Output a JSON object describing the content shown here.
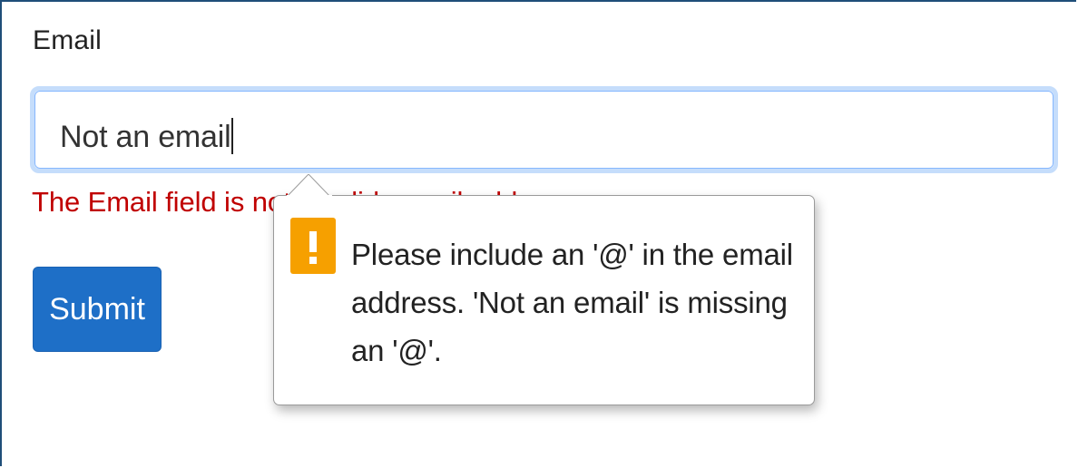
{
  "form": {
    "email_label": "Email",
    "email_value": "Not an email",
    "validation_message": "The Email field is not a valid e-mail address.",
    "submit_label": "Submit"
  },
  "tooltip": {
    "icon": "warning-icon",
    "icon_color": "#f6a000",
    "message": "Please include an '@' in the email address. 'Not an email' is missing an '@'."
  },
  "colors": {
    "error": "#c00000",
    "primary": "#1e6fc7",
    "focus_ring": "#c5ddfb"
  }
}
